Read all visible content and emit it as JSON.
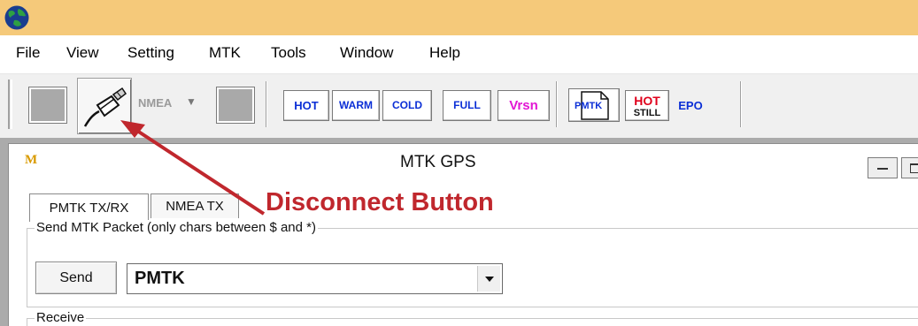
{
  "menu": {
    "items": [
      "File",
      "View",
      "Setting",
      "MTK",
      "Tools",
      "Window",
      "Help"
    ]
  },
  "toolbar": {
    "nmea_label": "NMEA",
    "buttons": {
      "hot": "HOT",
      "warm": "WARM",
      "cold": "COLD",
      "full": "FULL",
      "vrsn": "Vrsn",
      "pmtk": "PMTK",
      "hot_still_top": "HOT",
      "hot_still_bottom": "STILL",
      "epo": "EPO"
    }
  },
  "child_window": {
    "icon_letter": "M",
    "title": "MTK GPS",
    "tabs": [
      "PMTK TX/RX",
      "NMEA TX"
    ],
    "send_group_label": "Send MTK Packet (only chars between $ and *)",
    "send_button": "Send",
    "packet_value": "PMTK",
    "receive_group_label": "Receive"
  },
  "annotation": {
    "text": "Disconnect Button"
  },
  "colors": {
    "titlebar": "#f5c97a",
    "callout": "#c0272d",
    "hot": "#0b2fd6",
    "vrsn": "#e216d4",
    "hot_still": "#e0001b"
  }
}
